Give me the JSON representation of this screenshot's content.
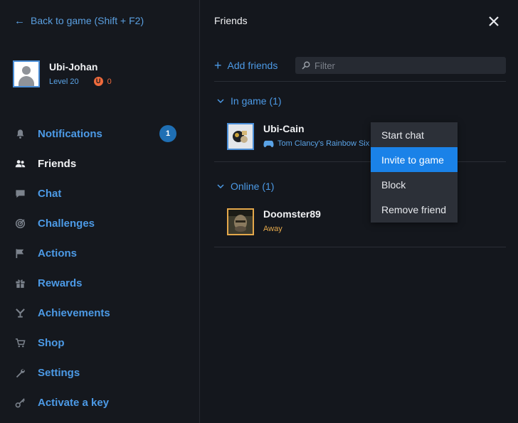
{
  "sidebar": {
    "back_link": "Back to game (Shift + F2)",
    "profile": {
      "name": "Ubi-Johan",
      "level": "Level 20",
      "units": "0"
    },
    "items": [
      {
        "label": "Notifications",
        "icon": "bell-icon",
        "badge": "1"
      },
      {
        "label": "Friends",
        "icon": "friends-icon",
        "active": true
      },
      {
        "label": "Chat",
        "icon": "chat-icon"
      },
      {
        "label": "Challenges",
        "icon": "target-icon"
      },
      {
        "label": "Actions",
        "icon": "flag-icon"
      },
      {
        "label": "Rewards",
        "icon": "gift-icon"
      },
      {
        "label": "Achievements",
        "icon": "trophy-icon"
      },
      {
        "label": "Shop",
        "icon": "cart-icon"
      },
      {
        "label": "Settings",
        "icon": "wrench-icon"
      },
      {
        "label": "Activate a key",
        "icon": "key-icon"
      }
    ]
  },
  "panel": {
    "title": "Friends",
    "add_friends": "Add friends",
    "filter_placeholder": "Filter",
    "sections": [
      {
        "title": "In game (1)",
        "friends": [
          {
            "name": "Ubi-Cain",
            "status": "Tom Clancy's Rainbow Six"
          }
        ]
      },
      {
        "title": "Online (1)",
        "friends": [
          {
            "name": "Doomster89",
            "status": "Away"
          }
        ]
      }
    ]
  },
  "context_menu": {
    "items": [
      "Start chat",
      "Invite to game",
      "Block",
      "Remove friend"
    ],
    "highlighted": "Invite to game"
  },
  "colors": {
    "accent": "#4c9ae6",
    "away": "#e4a84b",
    "units": "#ee6a3c",
    "menu_highlight": "#1a82e8"
  }
}
